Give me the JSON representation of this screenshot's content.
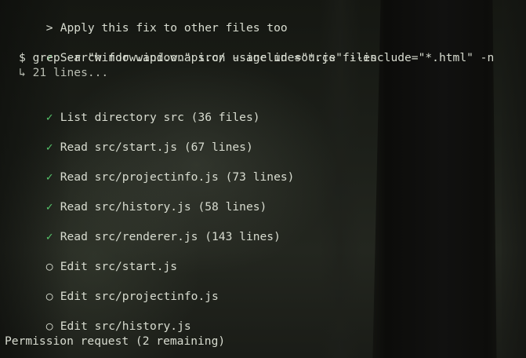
{
  "prompt": {
    "marker": ">",
    "text": "Apply this fix to other files too"
  },
  "entries": [
    {
      "marker": "✓",
      "text": "Search for window.api.on usage in source files",
      "command": "$ grep -r \"window.api.on\" src/ --include=\"*.js\" --include=\"*.html\" -n",
      "result": "↳ 21 lines..."
    },
    {
      "marker": "✓",
      "text": "List directory src (36 files)"
    },
    {
      "marker": "✓",
      "text": "Read src/start.js (67 lines)"
    },
    {
      "marker": "✓",
      "text": "Read src/projectinfo.js (73 lines)"
    },
    {
      "marker": "✓",
      "text": "Read src/history.js (58 lines)"
    },
    {
      "marker": "✓",
      "text": "Read src/renderer.js (143 lines)"
    },
    {
      "marker": "○",
      "text": "Edit src/start.js"
    },
    {
      "marker": "○",
      "text": "Edit src/projectinfo.js"
    },
    {
      "marker": "○",
      "text": "Edit src/history.js"
    }
  ],
  "footer": {
    "text": "Permission request (2 remaining)"
  },
  "colors": {
    "check": "#55c46a",
    "text": "#d8dcd0"
  },
  "icons": {
    "done": "check-icon",
    "pending": "pending-circle-icon"
  }
}
